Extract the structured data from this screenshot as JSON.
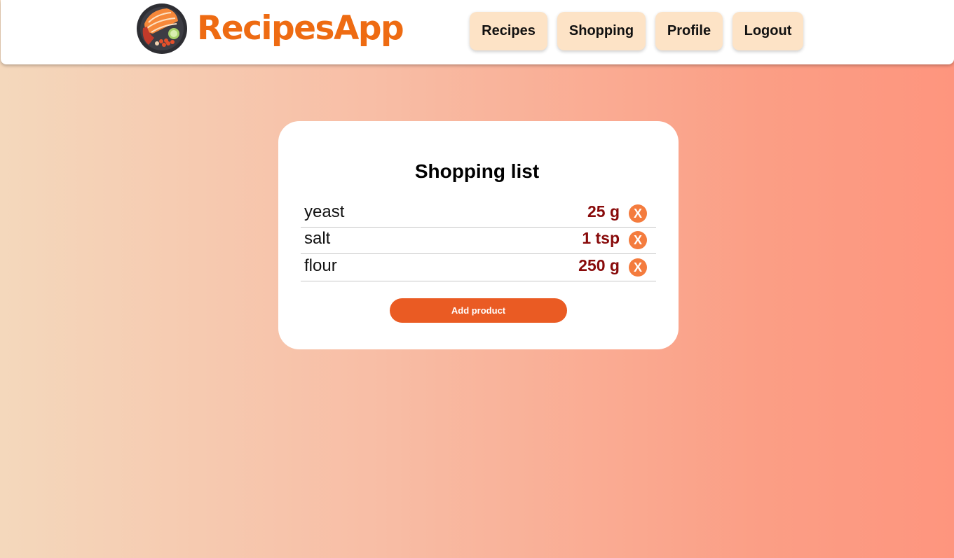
{
  "app": {
    "name": "RecipesApp",
    "brand_color": "#ee6b12"
  },
  "nav": {
    "items": [
      {
        "label": "Recipes"
      },
      {
        "label": "Shopping"
      },
      {
        "label": "Profile"
      },
      {
        "label": "Logout"
      }
    ],
    "button_color": "#fde3c6"
  },
  "shopping": {
    "title": "Shopping list",
    "items": [
      {
        "name": "yeast",
        "quantity": "25 g",
        "remove_label": "X"
      },
      {
        "name": "salt",
        "quantity": "1 tsp",
        "remove_label": "X"
      },
      {
        "name": "flour",
        "quantity": "250 g",
        "remove_label": "X"
      }
    ],
    "add_button": "Add product",
    "quantity_color": "#880a0a",
    "accent_color": "#ea5b23"
  },
  "icons": {
    "logo": "salmon-bowl-logo-icon",
    "remove": "remove-x-icon"
  }
}
